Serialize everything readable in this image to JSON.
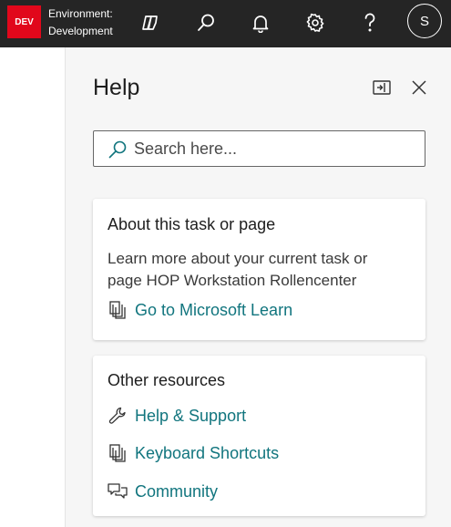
{
  "topbar": {
    "env_badge": "DEV",
    "env_label": "Environment:",
    "env_name": "Development",
    "avatar_initial": "S",
    "icons": [
      "copilot-icon",
      "search-icon",
      "bell-icon",
      "gear-icon",
      "help-icon"
    ]
  },
  "help": {
    "title": "Help",
    "search_placeholder": "Search here...",
    "about_card": {
      "title": "About this task or page",
      "description": "Learn more about your current task or page HOP Workstation Rollencenter",
      "link": "Go to Microsoft Learn"
    },
    "resources_card": {
      "title": "Other resources",
      "links": [
        "Help & Support",
        "Keyboard Shortcuts",
        "Community"
      ]
    }
  },
  "colors": {
    "topbar_bg": "#252525",
    "env_badge_bg": "#e1071b",
    "link_color": "#11757e",
    "pane_bg": "#f6f6f6"
  }
}
